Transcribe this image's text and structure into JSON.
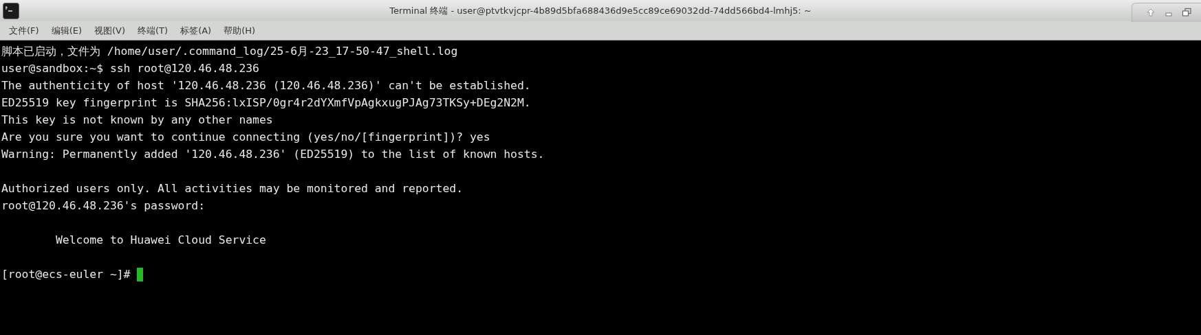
{
  "window": {
    "title": "Terminal 终端 - user@ptvtkvjcpr-4b89d5bfa688436d9e5cc89ce69032dd-74dd566bd4-lmhj5: ~"
  },
  "menu": [
    "文件(F)",
    "编辑(E)",
    "视图(V)",
    "终端(T)",
    "标签(A)",
    "帮助(H)"
  ],
  "terminal": {
    "lines": [
      {
        "text": "脚本已启动，文件为 /home/user/.command_log/25-6月-23_17-50-47_shell.log",
        "gap_before": false,
        "cursor": false
      },
      {
        "text": "user@sandbox:~$ ssh root@120.46.48.236",
        "gap_before": false,
        "cursor": false
      },
      {
        "text": "The authenticity of host '120.46.48.236 (120.46.48.236)' can't be established.",
        "gap_before": false,
        "cursor": false
      },
      {
        "text": "ED25519 key fingerprint is SHA256:lxISP/0gr4r2dYXmfVpAgkxugPJAg73TKSy+DEg2N2M.",
        "gap_before": false,
        "cursor": false
      },
      {
        "text": "This key is not known by any other names",
        "gap_before": false,
        "cursor": false
      },
      {
        "text": "Are you sure you want to continue connecting (yes/no/[fingerprint])? yes",
        "gap_before": false,
        "cursor": false
      },
      {
        "text": "Warning: Permanently added '120.46.48.236' (ED25519) to the list of known hosts.",
        "gap_before": false,
        "cursor": false
      },
      {
        "text": "Authorized users only. All activities may be monitored and reported.",
        "gap_before": true,
        "cursor": false
      },
      {
        "text": "root@120.46.48.236's password:",
        "gap_before": false,
        "cursor": false
      },
      {
        "text": "        Welcome to Huawei Cloud Service",
        "gap_before": true,
        "cursor": false
      },
      {
        "text": "[root@ecs-euler ~]# ",
        "gap_before": true,
        "cursor": true
      }
    ]
  }
}
